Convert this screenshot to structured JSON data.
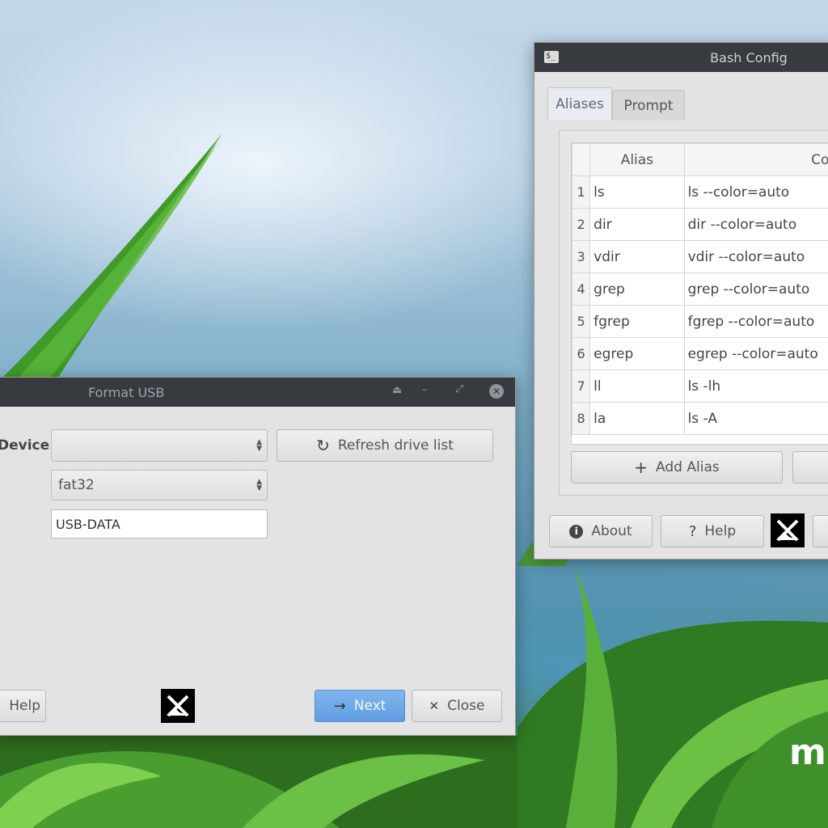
{
  "bash_config": {
    "title": "Bash Config",
    "tabs": [
      {
        "label": "Aliases",
        "active": true
      },
      {
        "label": "Prompt",
        "active": false
      }
    ],
    "table": {
      "headers": [
        "Alias",
        "Com"
      ],
      "rows": [
        {
          "n": "1",
          "alias": "ls",
          "command": "ls --color=auto"
        },
        {
          "n": "2",
          "alias": "dir",
          "command": "dir --color=auto"
        },
        {
          "n": "3",
          "alias": "vdir",
          "command": "vdir --color=auto"
        },
        {
          "n": "4",
          "alias": "grep",
          "command": "grep --color=auto"
        },
        {
          "n": "5",
          "alias": "fgrep",
          "command": "fgrep --color=auto"
        },
        {
          "n": "6",
          "alias": "egrep",
          "command": "egrep --color=auto"
        },
        {
          "n": "7",
          "alias": "ll",
          "command": "ls -lh"
        },
        {
          "n": "8",
          "alias": "la",
          "command": "ls -A"
        }
      ]
    },
    "add_alias_label": "Add Alias",
    "about_label": "About",
    "help_label": "Help"
  },
  "format_usb": {
    "title": "Format USB",
    "device_label": "Device",
    "device_value": "",
    "refresh_label": "Refresh drive list",
    "filesystem_value": "fat32",
    "label_value": "USB-DATA",
    "help_label": "Help",
    "next_label": "Next",
    "close_label": "Close"
  },
  "desktop": {
    "brand_text": "m"
  },
  "colors": {
    "titlebar": "#373a3f",
    "next_button": "#6fa8e6",
    "window_bg": "#e3e3e3"
  }
}
